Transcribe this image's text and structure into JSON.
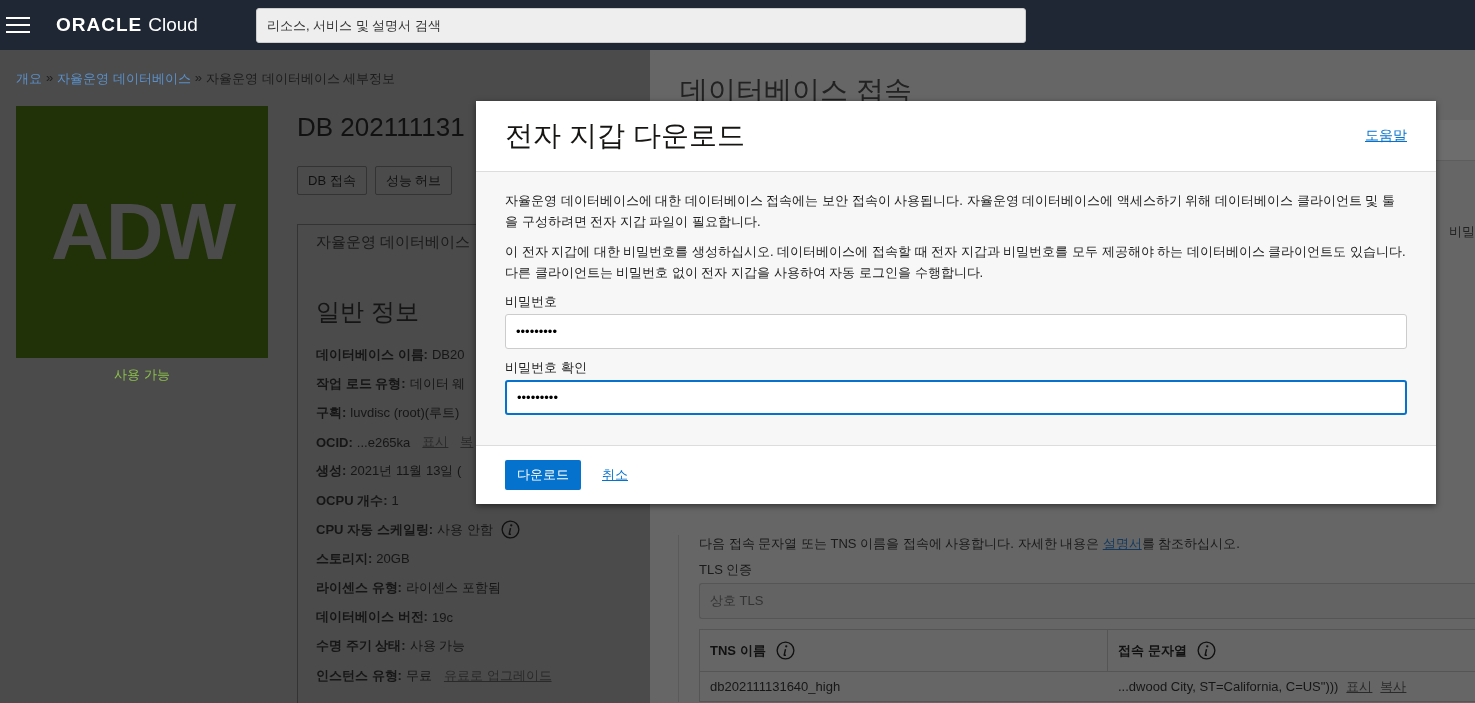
{
  "top_bar": {
    "logo": {
      "brand": "ORACLE",
      "product": "Cloud"
    },
    "search": {
      "placeholder": "리소스, 서비스 및 설명서 검색"
    }
  },
  "breadcrumb": [
    {
      "label": "개요",
      "link": true
    },
    {
      "label": "»",
      "link": false
    },
    {
      "label": "자율운영 데이터베이스",
      "link": true
    },
    {
      "label": "»",
      "link": false
    },
    {
      "label": "자율운영 데이터베이스 세부정보",
      "link": false
    }
  ],
  "tile": {
    "text": "ADW",
    "status": "사용 가능"
  },
  "database": {
    "title": "DB 202111131",
    "buttons": [
      "DB 접속",
      "성능 허브"
    ],
    "tab": "자율운영 데이터베이스",
    "section": "일반 정보",
    "fields": [
      {
        "label": "데이터베이스 이름:",
        "value": "DB20"
      },
      {
        "label": "작업 로드 유형:",
        "value": "데이터 웨"
      },
      {
        "label": "구획:",
        "value": "luvdisc (root)(루트)"
      },
      {
        "label": "OCID:",
        "value": "...e265ka",
        "links": [
          "표시",
          "복"
        ]
      },
      {
        "label": "생성:",
        "value": "2021년 11월 13일 ("
      },
      {
        "label": "OCPU 개수:",
        "value": "1"
      },
      {
        "label": "CPU 자동 스케일링:",
        "value": "사용 안함",
        "info": true
      },
      {
        "label": "스토리지:",
        "value": "20GB"
      },
      {
        "label": "라이센스 유형:",
        "value": "라이센스 포함됨"
      },
      {
        "label": "데이터베이스 버전:",
        "value": "19c"
      },
      {
        "label": "수명 주기 상태:",
        "value": "사용 가능"
      },
      {
        "label": "인스턴스 유형:",
        "value": "무료",
        "links": [
          "유료로 업그레이드"
        ]
      }
    ]
  },
  "connection_panel": {
    "title": "데이터베이스 접속",
    "fragment": "비밀",
    "description": {
      "before": "다음 접속 문자열 또는 TNS 이름을 접속에 사용합니다. 자세한 내용은 ",
      "link": "설명서",
      "after": "를 참조하십시오."
    },
    "tls": {
      "label": "TLS 인증",
      "value": "상호 TLS"
    },
    "table": {
      "columns": [
        "TNS 이름",
        "접속 문자열"
      ],
      "rows": [
        {
          "tns_name": "db202111131640_high",
          "connection_string": "...dwood City, ST=California, C=US\")))",
          "actions": [
            "표시",
            "복사"
          ]
        }
      ]
    }
  },
  "dialog": {
    "title": "전자 지갑 다운로드",
    "help": "도움말",
    "paragraphs": [
      "자율운영 데이터베이스에 대한 데이터베이스 접속에는 보안 접속이 사용됩니다. 자율운영 데이터베이스에 액세스하기 위해 데이터베이스 클라이언트 및 툴을 구성하려면 전자 지갑 파일이 필요합니다.",
      "이 전자 지갑에 대한 비밀번호를 생성하십시오. 데이터베이스에 접속할 때 전자 지갑과 비밀번호를 모두 제공해야 하는 데이터베이스 클라이언트도 있습니다. 다른 클라이언트는 비밀번호 없이 전자 지갑을 사용하여 자동 로그인을 수행합니다."
    ],
    "fields": [
      {
        "label": "비밀번호",
        "value": "•••••••••",
        "focused": false
      },
      {
        "label": "비밀번호 확인",
        "value": "•••••••••",
        "focused": true
      }
    ],
    "primary": "다운로드",
    "cancel": "취소"
  }
}
